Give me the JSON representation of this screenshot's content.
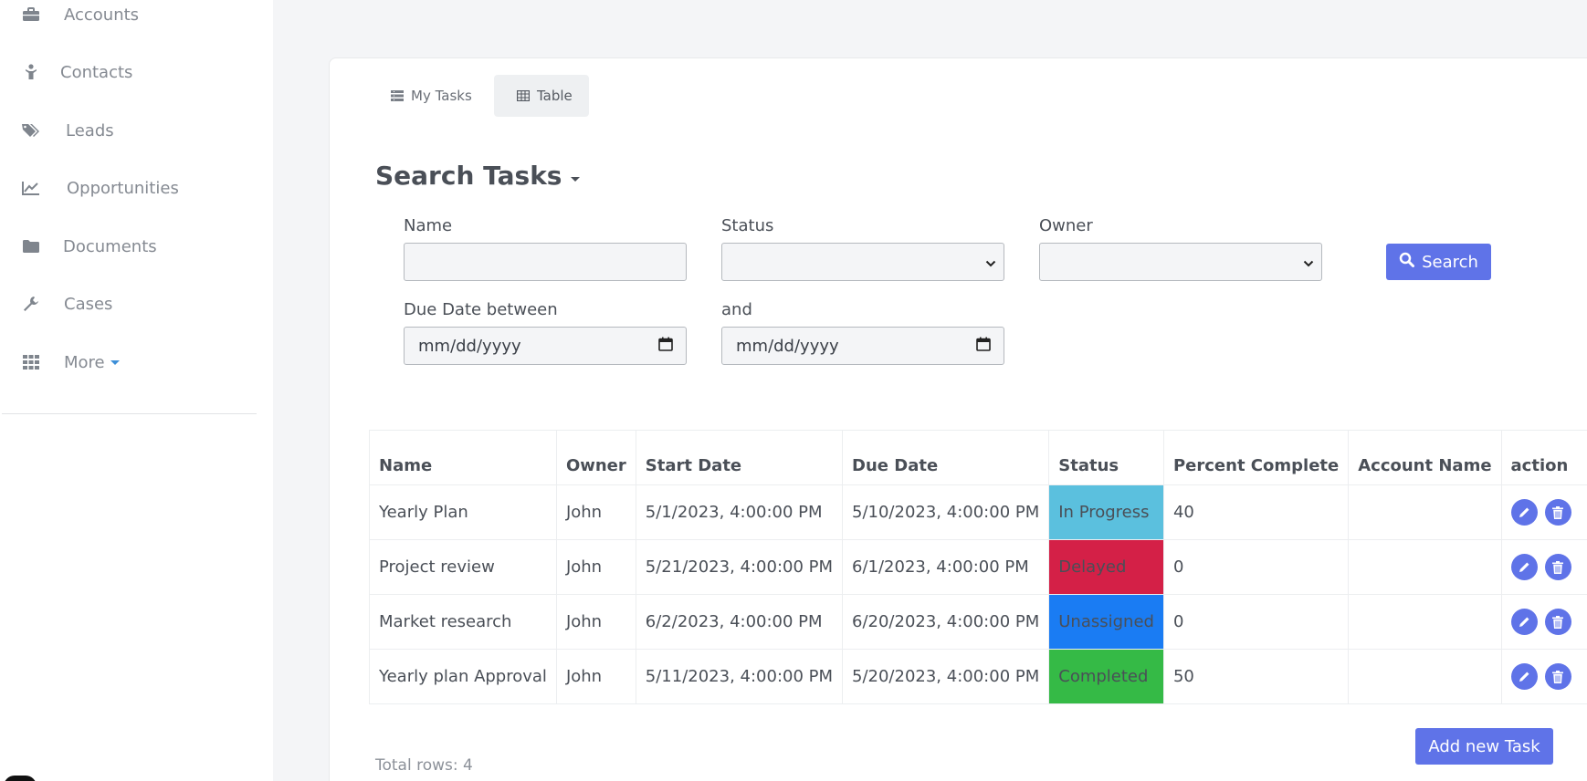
{
  "sidebar": {
    "items": [
      {
        "label": "Accounts",
        "icon": "briefcase-icon"
      },
      {
        "label": "Contacts",
        "icon": "person-icon"
      },
      {
        "label": "Leads",
        "icon": "tags-icon"
      },
      {
        "label": "Opportunities",
        "icon": "line-chart-icon"
      },
      {
        "label": "Documents",
        "icon": "folder-icon"
      },
      {
        "label": "Cases",
        "icon": "wrench-icon"
      },
      {
        "label": "More",
        "icon": "grid-icon"
      }
    ]
  },
  "tabs": {
    "my_tasks": "My Tasks",
    "table": "Table"
  },
  "search": {
    "title": "Search Tasks",
    "name_label": "Name",
    "name_value": "",
    "status_label": "Status",
    "status_value": "",
    "owner_label": "Owner",
    "owner_value": "",
    "due_label": "Due Date between",
    "due_from": "mm/dd/yyyy",
    "and_label": "and",
    "due_to": "mm/dd/yyyy",
    "button": "Search"
  },
  "table": {
    "headers": [
      "Name",
      "Owner",
      "Start Date",
      "Due Date",
      "Status",
      "Percent Complete",
      "Account Name",
      "action"
    ],
    "rows": [
      {
        "name": "Yearly Plan",
        "owner": "John",
        "start": "5/1/2023, 4:00:00 PM",
        "due": "5/10/2023, 4:00:00 PM",
        "status": "In Progress",
        "percent": "40",
        "account": ""
      },
      {
        "name": "Project review",
        "owner": "John",
        "start": "5/21/2023, 4:00:00 PM",
        "due": "6/1/2023, 4:00:00 PM",
        "status": "Delayed",
        "percent": "0",
        "account": ""
      },
      {
        "name": "Market research",
        "owner": "John",
        "start": "6/2/2023, 4:00:00 PM",
        "due": "6/20/2023, 4:00:00 PM",
        "status": "Unassigned",
        "percent": "0",
        "account": ""
      },
      {
        "name": "Yearly plan Approval",
        "owner": "John",
        "start": "5/11/2023, 4:00:00 PM",
        "due": "5/20/2023, 4:00:00 PM",
        "status": "Completed",
        "percent": "50",
        "account": ""
      }
    ]
  },
  "status_colors": {
    "In Progress": "#5bc0de",
    "Delayed": "#d42047",
    "Unassigned": "#1a7cf3",
    "Completed": "#35ba46"
  },
  "footer": {
    "total_rows": "Total rows: 4",
    "add_button": "Add new Task"
  },
  "colors": {
    "accent": "#5f73e8"
  }
}
